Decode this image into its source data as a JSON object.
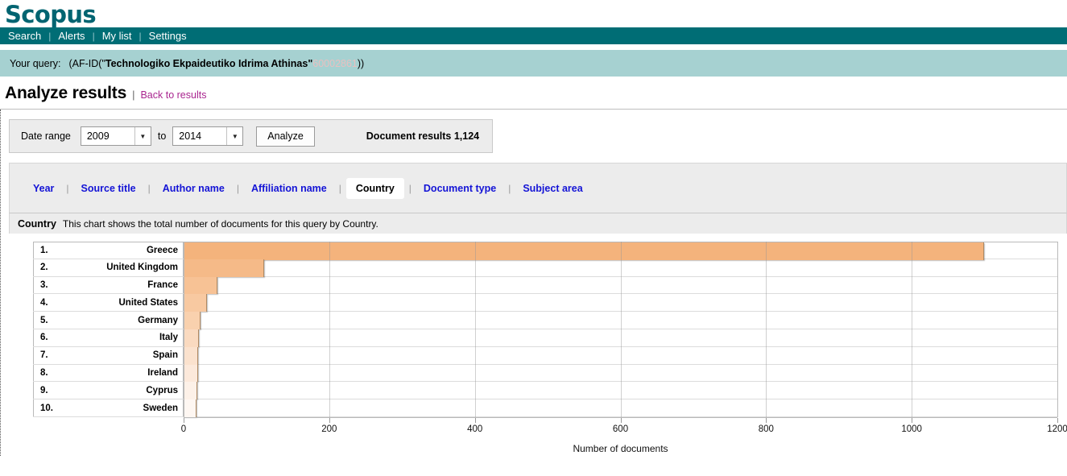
{
  "brand": {
    "name": "Scopus"
  },
  "nav": {
    "items": [
      {
        "label": "Search"
      },
      {
        "label": "Alerts"
      },
      {
        "label": "My list"
      },
      {
        "label": "Settings"
      }
    ],
    "separator": "|"
  },
  "query": {
    "label": "Your query:",
    "prefix": "(AF-ID(\"",
    "affiliation": "Technologiko Ekpaideutiko Idrima Athinas",
    "quote_close": "\"",
    "id": "60002861",
    "suffix": "))"
  },
  "header": {
    "title": "Analyze results",
    "pipe": "|",
    "back_link": "Back to results"
  },
  "controls": {
    "date_range_label": "Date range",
    "from_year": "2009",
    "to_label": "to",
    "to_year": "2014",
    "analyze_button": "Analyze",
    "document_results": "Document results 1,124",
    "dropdown_icon": "chevron-down-icon"
  },
  "tabs": {
    "separator": "|",
    "items": [
      {
        "label": "Year",
        "active": false
      },
      {
        "label": "Source title",
        "active": false
      },
      {
        "label": "Author name",
        "active": false
      },
      {
        "label": "Affiliation name",
        "active": false
      },
      {
        "label": "Country",
        "active": true
      },
      {
        "label": "Document type",
        "active": false
      },
      {
        "label": "Subject area",
        "active": false
      }
    ]
  },
  "chart_header": {
    "key": "Country",
    "description": "This chart shows the total number of documents for this query by Country."
  },
  "chart_data": {
    "type": "bar",
    "orientation": "horizontal",
    "title": "",
    "xlabel": "Number of documents",
    "ylabel": "",
    "xlim": [
      0,
      1200
    ],
    "xticks": [
      0,
      200,
      400,
      600,
      800,
      1000,
      1200
    ],
    "grid": true,
    "legend": "none",
    "categories": [
      "Greece",
      "United Kingdom",
      "France",
      "United States",
      "Germany",
      "Italy",
      "Spain",
      "Ireland",
      "Cyprus",
      "Sweden"
    ],
    "values": [
      1099,
      111,
      46,
      32,
      23,
      21,
      20,
      20,
      19,
      18
    ],
    "ranks": [
      "1.",
      "2.",
      "3.",
      "4.",
      "5.",
      "6.",
      "7.",
      "8.",
      "9.",
      "10."
    ],
    "bar_colors": [
      "#F4B37C",
      "#F5BA88",
      "#F7C295",
      "#F8C9A1",
      "#F9D1AE",
      "#FADAC0",
      "#FBE2CE",
      "#FCE9DB",
      "#FDF1E8",
      "#FEF7F2"
    ]
  }
}
